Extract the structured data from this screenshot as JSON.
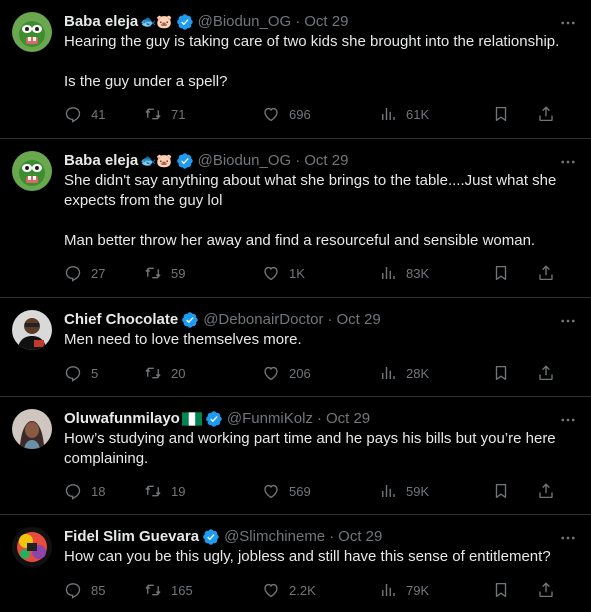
{
  "colors": {
    "background": "#000000",
    "text": "#e7e9ea",
    "muted": "#71767b",
    "divider": "#2f3336",
    "verified": "#1d9bf0"
  },
  "tweets": [
    {
      "name": "Baba eleja",
      "emoji": "🐟🐷",
      "handle": "@Biodun_OG",
      "sep": "·",
      "date": "Oct 29",
      "text1": "Hearing the guy is taking care of two kids she brought into the relationship.",
      "text2": "Is the guy under a spell?",
      "replies": "41",
      "retweets": "71",
      "likes": "696",
      "views": "61K"
    },
    {
      "name": "Baba eleja",
      "emoji": "🐟🐷",
      "handle": "@Biodun_OG",
      "sep": "·",
      "date": "Oct 29",
      "text1": "She didn't say anything about what she brings to the table....Just what she expects from the guy lol",
      "text2": "Man better throw her away and find a resourceful and sensible woman.",
      "replies": "27",
      "retweets": "59",
      "likes": "1K",
      "views": "83K"
    },
    {
      "name": "Chief Chocolate",
      "handle": "@DebonairDoctor",
      "sep": "·",
      "date": "Oct 29",
      "text1": "Men need to love themselves more.",
      "replies": "5",
      "retweets": "20",
      "likes": "206",
      "views": "28K"
    },
    {
      "name": "Oluwafunmilayo",
      "handle": "@FunmiKolz",
      "sep": "·",
      "date": "Oct 29",
      "text1": "How’s studying and working part time and he pays his bills but you’re here complaining.",
      "replies": "18",
      "retweets": "19",
      "likes": "569",
      "views": "59K"
    },
    {
      "name": "Fidel Slim Guevara",
      "handle": "@Slimchineme",
      "sep": "·",
      "date": "Oct 29",
      "text1": "How can you be this ugly, jobless and still have this sense of entitlement?",
      "replies": "85",
      "retweets": "165",
      "likes": "2.2K",
      "views": "79K"
    }
  ]
}
